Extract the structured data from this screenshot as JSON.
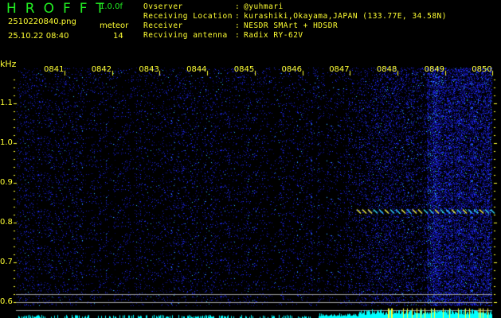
{
  "header": {
    "app_title": "HROFFT",
    "version": "1.0.0f",
    "filename": "2510220840.png",
    "datetime": "25.10.22 08:40",
    "meteor_label": "meteor",
    "meteor_count": "14"
  },
  "station": {
    "rows": [
      {
        "label": "Ovserver",
        "sep": ":",
        "value": "@yuhmari"
      },
      {
        "label": "Receiving Location",
        "sep": ":",
        "value": "kurashiki,Okayama,JAPAN (133.77E, 34.58N)"
      },
      {
        "label": "Receiver",
        "sep": ":",
        "value": "NESDR SMArt + HDSDR"
      },
      {
        "label": "Recviving antenna",
        "sep": ":",
        "value": "Radix RY-62V"
      }
    ]
  },
  "colors": {
    "text": "#ffff33",
    "title": "#22ee22",
    "bars": "#00ffff",
    "noise": "#1a1aff"
  },
  "chart_data": {
    "type": "heatmap",
    "ylabel": "kHz",
    "x_ticks": [
      "0841",
      "0842",
      "0843",
      "0844",
      "0845",
      "0846",
      "0847",
      "0848",
      "0849",
      "0850"
    ],
    "y_ticks": [
      "1.1",
      "1.0",
      "0.9",
      "0.8",
      "0.7",
      "0.6"
    ],
    "ylim": [
      0.56,
      1.19
    ],
    "meteor_trace": {
      "freq_khz": 0.825,
      "start": "0847.7",
      "end": "0850"
    }
  }
}
